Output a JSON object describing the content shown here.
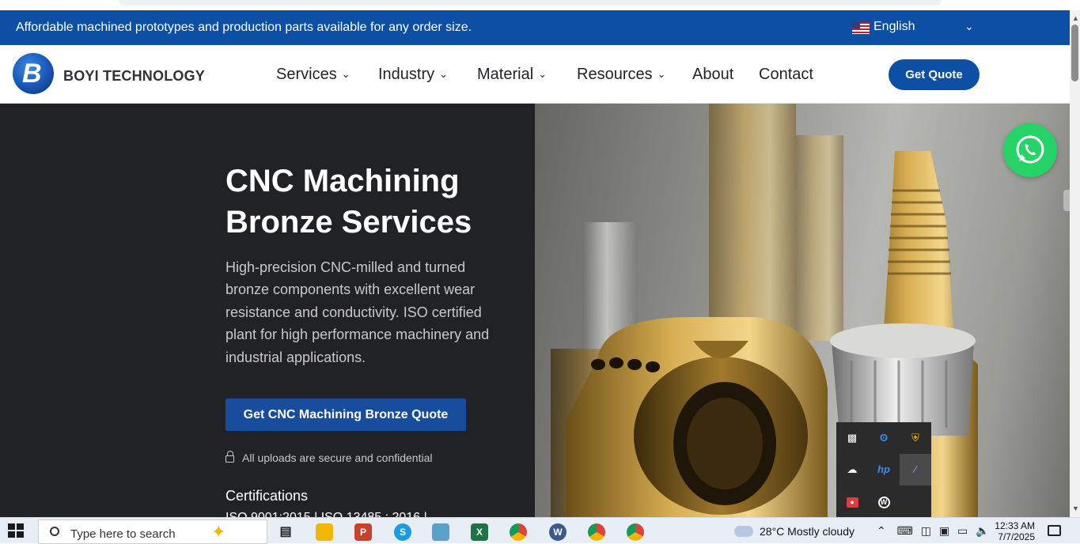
{
  "announcement": "Affordable machined prototypes and production parts available for any order size.",
  "language": {
    "label": "English"
  },
  "brand": {
    "name": "BOYI TECHNOLOGY",
    "mark": "B"
  },
  "nav": {
    "items": [
      {
        "label": "Services",
        "dropdown": true
      },
      {
        "label": "Industry",
        "dropdown": true
      },
      {
        "label": "Material",
        "dropdown": true
      },
      {
        "label": "Resources",
        "dropdown": true
      },
      {
        "label": "About",
        "dropdown": false
      },
      {
        "label": "Contact",
        "dropdown": false
      }
    ],
    "cta": "Get Quote"
  },
  "hero": {
    "title_line1": "CNC Machining",
    "title_line2": "Bronze Services",
    "description": "High-precision CNC-milled and turned bronze components with excellent wear resistance and conductivity. ISO certified plant for high performance machinery and industrial applications.",
    "cta": "Get CNC Machining Bronze Quote",
    "secure_note": "All uploads are secure and confidential",
    "certifications_heading": "Certifications",
    "certifications_text": "ISO 9001:2015 | ISO 13485 : 2016 |"
  },
  "tray_icons": [
    "display-icon",
    "bluetooth-icon",
    "security-icon",
    "cloud-off-icon",
    "hp-icon",
    "pen-icon",
    "record-icon",
    "w-icon"
  ],
  "taskbar": {
    "search_placeholder": "Type here to search",
    "weather": "28°C  Mostly cloudy",
    "time": "12:33 AM",
    "date": "7/7/2025",
    "apps": [
      {
        "name": "task-view",
        "color": "#2b2b2b"
      },
      {
        "name": "file-explorer",
        "color": "#f2b705"
      },
      {
        "name": "app-p",
        "color": "#c8412a"
      },
      {
        "name": "skype",
        "color": "#1a9de0"
      },
      {
        "name": "app-cube",
        "color": "#5aa0c8"
      },
      {
        "name": "excel",
        "color": "#1f7244"
      },
      {
        "name": "chrome",
        "color": "#db4437"
      },
      {
        "name": "app-w",
        "color": "#3a5a8c"
      },
      {
        "name": "chrome-profile-1",
        "color": "#db4437"
      },
      {
        "name": "chrome-profile-2",
        "color": "#db4437"
      }
    ]
  },
  "colors": {
    "brand_blue": "#0c4fa4",
    "hero_dark": "#212226",
    "cta_blue": "#184c9c",
    "whatsapp_green": "#25d366"
  }
}
